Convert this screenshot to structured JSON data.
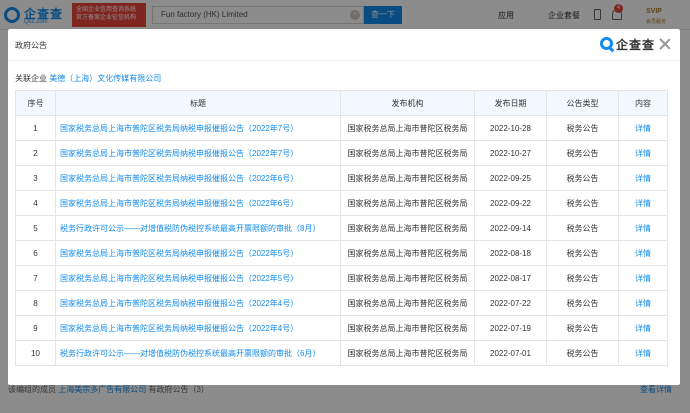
{
  "topbar": {
    "logo": "企查查",
    "logo_sub": "Qcc.com",
    "promo_lines": [
      "全国企业信用查询系统",
      "官方备案企业征信机构"
    ],
    "search_value": "Fun factory (HK) Limited",
    "search_button": "查一下",
    "nav_app": "应用",
    "nav_enterprise": "企业套餐",
    "notification_count": "4",
    "svip": "SVIP",
    "svip_sub": "会员服务"
  },
  "background": {
    "footer_prefix": "该编组的成员",
    "footer_link": "上海美宗多广告有限公司",
    "footer_suffix": "有政府公告（3）",
    "footer_right": "查看详情"
  },
  "modal": {
    "title": "政府公告",
    "brand": "企查查",
    "related_label": "关联企业",
    "related_company": "美德（上海）文化传媒有限公司",
    "columns": [
      "序号",
      "标题",
      "发布机构",
      "发布日期",
      "公告类型",
      "内容"
    ],
    "rows": [
      {
        "no": "1",
        "title": "国家税务总局上海市普陀区税务局纳税申报催报公告（2022年7号）",
        "org": "国家税务总局上海市普陀区税务局",
        "date": "2022-10-28",
        "type": "税务公告",
        "detail": "详情"
      },
      {
        "no": "2",
        "title": "国家税务总局上海市普陀区税务局纳税申报催报公告（2022年7号）",
        "org": "国家税务总局上海市普陀区税务局",
        "date": "2022-10-27",
        "type": "税务公告",
        "detail": "详情"
      },
      {
        "no": "3",
        "title": "国家税务总局上海市普陀区税务局纳税申报催报公告（2022年6号）",
        "org": "国家税务总局上海市普陀区税务局",
        "date": "2022-09-25",
        "type": "税务公告",
        "detail": "详情"
      },
      {
        "no": "4",
        "title": "国家税务总局上海市普陀区税务局纳税申报催报公告（2022年6号）",
        "org": "国家税务总局上海市普陀区税务局",
        "date": "2022-09-22",
        "type": "税务公告",
        "detail": "详情"
      },
      {
        "no": "5",
        "title": "税务行政许可公示——对增值税防伪税控系统最高开票限额的审批（8月）",
        "org": "国家税务总局上海市普陀区税务局",
        "date": "2022-09-14",
        "type": "税务公告",
        "detail": "详情"
      },
      {
        "no": "6",
        "title": "国家税务总局上海市普陀区税务局纳税申报催报公告（2022年5号）",
        "org": "国家税务总局上海市普陀区税务局",
        "date": "2022-08-18",
        "type": "税务公告",
        "detail": "详情"
      },
      {
        "no": "7",
        "title": "国家税务总局上海市普陀区税务局纳税申报催报公告（2022年5号）",
        "org": "国家税务总局上海市普陀区税务局",
        "date": "2022-08-17",
        "type": "税务公告",
        "detail": "详情"
      },
      {
        "no": "8",
        "title": "国家税务总局上海市普陀区税务局纳税申报催报公告（2022年4号）",
        "org": "国家税务总局上海市普陀区税务局",
        "date": "2022-07-22",
        "type": "税务公告",
        "detail": "详情"
      },
      {
        "no": "9",
        "title": "国家税务总局上海市普陀区税务局纳税申报催报公告（2022年4号）",
        "org": "国家税务总局上海市普陀区税务局",
        "date": "2022-07-19",
        "type": "税务公告",
        "detail": "详情"
      },
      {
        "no": "10",
        "title": "税务行政许可公示——对增值税防伪税控系统最高开票限额的审批（6月）",
        "org": "国家税务总局上海市普陀区税务局",
        "date": "2022-07-01",
        "type": "税务公告",
        "detail": "详情"
      }
    ]
  }
}
